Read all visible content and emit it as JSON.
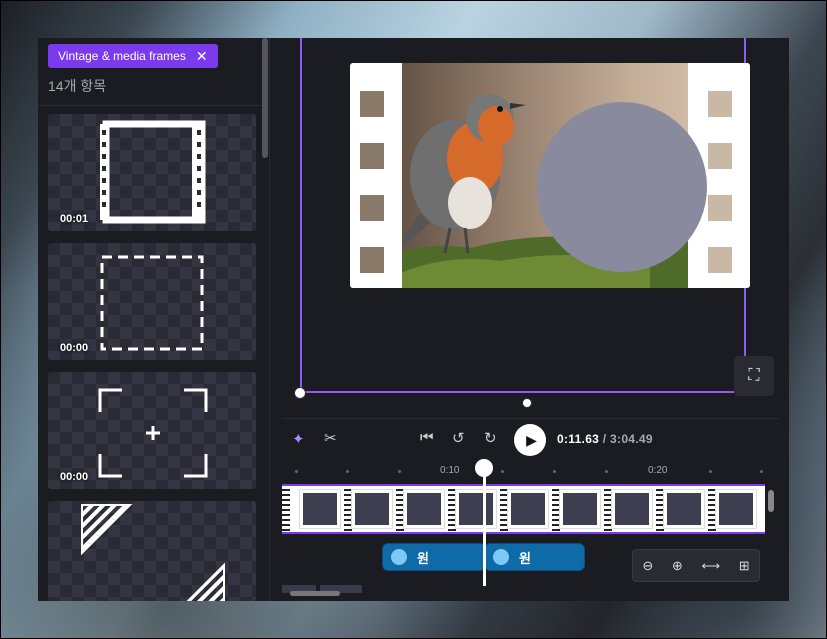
{
  "filter_chip": {
    "label": "Vintage & media frames",
    "close_icon": "close-icon"
  },
  "results": {
    "count_label": "14개 항목"
  },
  "tiles": [
    {
      "duration": "00:01",
      "kind": "film-strip-frame"
    },
    {
      "duration": "00:00",
      "kind": "dashed-square-frame"
    },
    {
      "duration": "00:00",
      "kind": "viewfinder-corners"
    },
    {
      "duration": "",
      "kind": "striped-corner-triangles"
    }
  ],
  "player": {
    "current_time": "0:11.63",
    "separator": " / ",
    "total_time": "3:04.49",
    "icons": [
      "sparkle-icon",
      "scissors-icon",
      "skip-start-icon",
      "rewind-5-icon",
      "forward-5-icon",
      "play-icon"
    ]
  },
  "timeline": {
    "ruler_labels": [
      "0:10",
      "0:20"
    ],
    "clips": [
      {
        "label": "원"
      },
      {
        "label": "원"
      }
    ],
    "zoom_icons": [
      "zoom-out-icon",
      "zoom-in-icon",
      "fit-width-icon",
      "add-track-icon"
    ]
  },
  "colors": {
    "accent": "#7c3aed",
    "clip_fill": "#0e6ba8",
    "panel_bg": "#1b1b22"
  }
}
